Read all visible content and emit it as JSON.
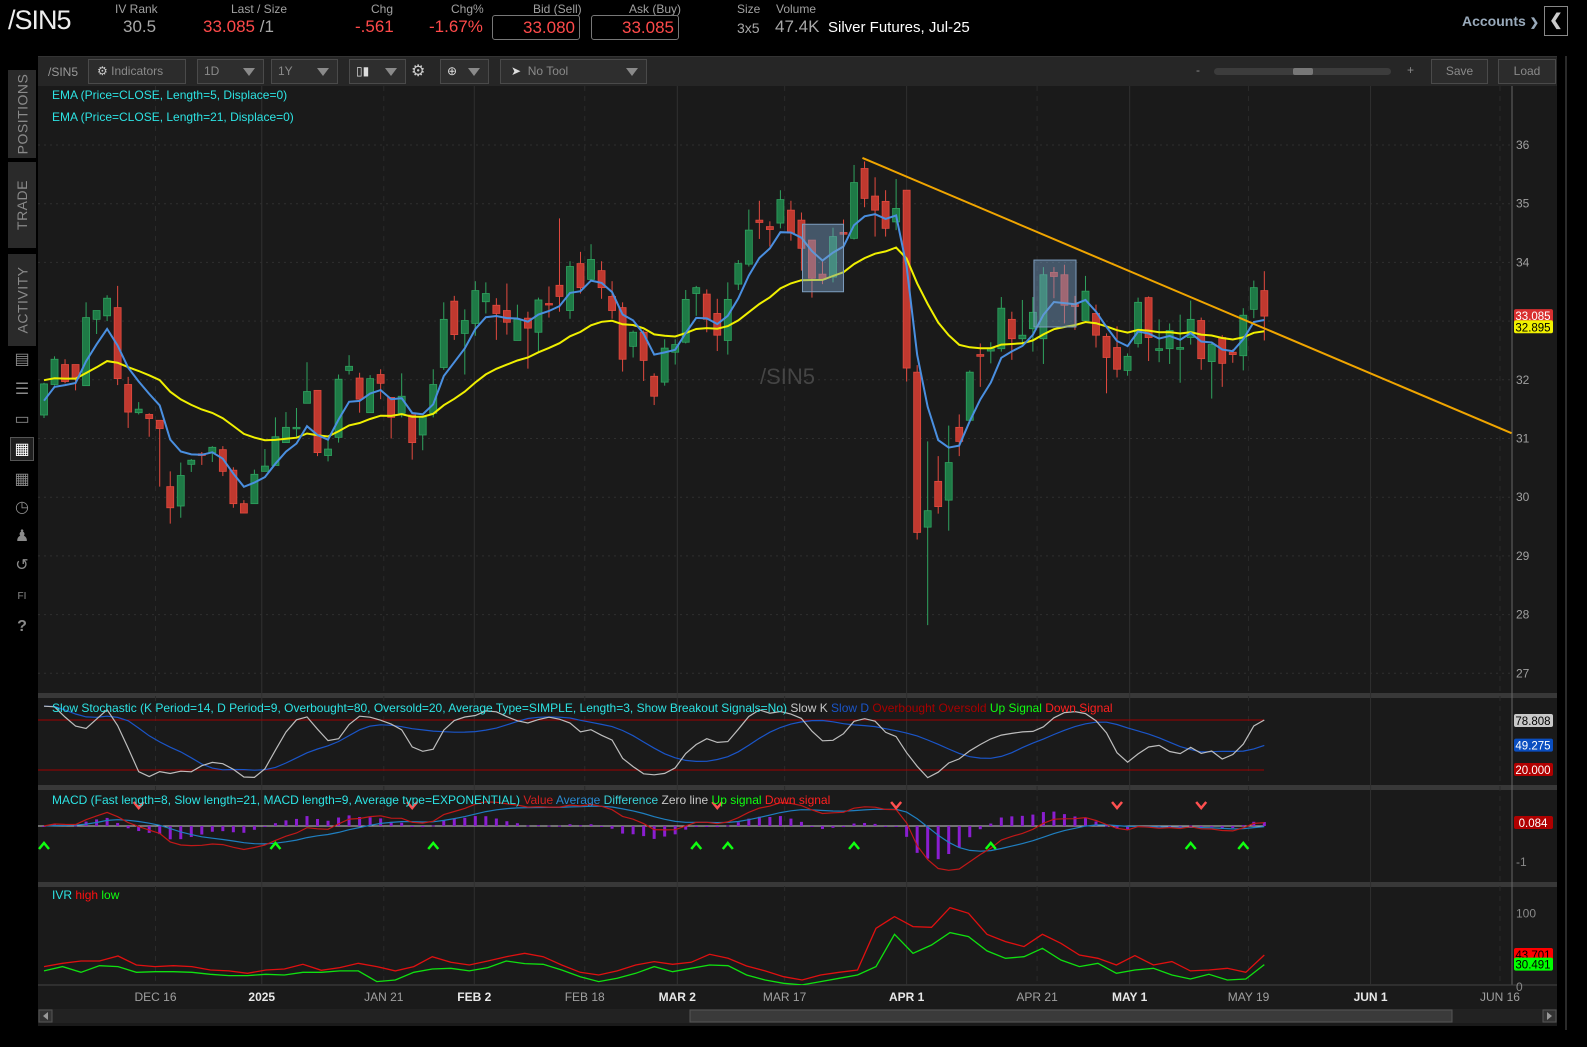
{
  "header": {
    "symbol": "/SIN5",
    "iv_rank_label": "IV Rank",
    "iv_rank": "30.5",
    "last_size_label": "Last / Size",
    "last": "33.085",
    "size_suffix": "/1",
    "chg_label": "Chg",
    "chg": "-.561",
    "chg_pct_label": "Chg%",
    "chg_pct": "-1.67%",
    "bid_label": "Bid (Sell)",
    "bid": "33.080",
    "ask_label": "Ask (Buy)",
    "ask": "33.085",
    "size_label": "Size",
    "size": "3x5",
    "volume_label": "Volume",
    "volume": "47.4K",
    "description": "Silver Futures, Jul-25",
    "accounts_label": "Accounts"
  },
  "sidebar": {
    "tabs": [
      "POSITIONS",
      "TRADE",
      "ACTIVITY"
    ],
    "icons": [
      "reports-icon",
      "list-icon",
      "tv-icon",
      "chart-grid-icon",
      "layout-icon",
      "clock-icon",
      "community-icon",
      "history-icon",
      "fi-icon",
      "help-icon"
    ]
  },
  "toolbar": {
    "symbol": "/SIN5",
    "indicators": "Indicators",
    "aggregation": "1D",
    "time_frame": "1Y",
    "tool": "No Tool",
    "zoom_minus": "-",
    "zoom_plus": "+",
    "save": "Save",
    "load": "Load",
    "zoom_level": 0.5
  },
  "studies": {
    "ema5": "EMA (Price=CLOSE, Length=5, Displace=0)",
    "ema21": "EMA (Price=CLOSE, Length=21, Displace=0)",
    "watermark": "/SIN5",
    "stoch": {
      "title": "Slow Stochastic (K Period=14, D Period=9, Overbought=80, Oversold=20, Average Type=SIMPLE, Length=3, Show Breakout Signals=No)",
      "slow_k": "Slow K",
      "slow_d": "Slow D",
      "overbought": "Overbought",
      "oversold": "Oversold",
      "up": "Up Signal",
      "down": "Down Signal"
    },
    "macd": {
      "title": "MACD (Fast length=8, Slow length=21, MACD length=9, Average type=EXPONENTIAL)",
      "value": "Value",
      "average": "Average",
      "difference": "Difference",
      "zero": "Zero line",
      "up": "Up signal",
      "down": "Down signal"
    },
    "ivr": {
      "title": "IVR",
      "high": "high",
      "low": "low"
    }
  },
  "colors": {
    "up_candle": "#1e7a46",
    "up_border": "#2fa35f",
    "down_candle": "#c0392f",
    "down_border": "#e24a3f",
    "ema5": "#4a8fe0",
    "ema21": "#f0f000",
    "trendline": "#f0a500"
  },
  "chart_data": {
    "type": "candlestick",
    "title": "/SIN5",
    "ylim": [
      26.6,
      36.7
    ],
    "price_ticks": [
      27,
      28,
      29,
      30,
      31,
      32,
      33,
      34,
      35,
      36
    ],
    "x_labels": [
      {
        "text": "DEC 16",
        "index": 10.6,
        "major": false
      },
      {
        "text": "2025",
        "index": 20.7,
        "major": true
      },
      {
        "text": "JAN 21",
        "index": 32.3,
        "major": false
      },
      {
        "text": "FEB 2",
        "index": 40.9,
        "major": true
      },
      {
        "text": "FEB 18",
        "index": 51.4,
        "major": false
      },
      {
        "text": "MAR 2",
        "index": 60.2,
        "major": true
      },
      {
        "text": "MAR 17",
        "index": 70.4,
        "major": false
      },
      {
        "text": "APR 1",
        "index": 82.0,
        "major": true
      },
      {
        "text": "APR 21",
        "index": 94.4,
        "major": false
      },
      {
        "text": "MAY 1",
        "index": 103.2,
        "major": true
      },
      {
        "text": "MAY 19",
        "index": 114.5,
        "major": false
      },
      {
        "text": "JUN 1",
        "index": 126.1,
        "major": true
      },
      {
        "text": "JUN 16",
        "index": 138.4,
        "major": false
      }
    ],
    "ohlc": [
      [
        31.4,
        31.95,
        31.35,
        31.93
      ],
      [
        31.92,
        32.4,
        31.9,
        32.35
      ],
      [
        32.26,
        32.35,
        31.94,
        31.97
      ],
      [
        32.26,
        32.26,
        31.82,
        32.02
      ],
      [
        31.9,
        33.32,
        31.9,
        33.06
      ],
      [
        33.03,
        33.18,
        32.78,
        33.18
      ],
      [
        33.09,
        33.44,
        33.0,
        33.39
      ],
      [
        33.23,
        33.6,
        31.91,
        32.02
      ],
      [
        31.92,
        32.05,
        31.18,
        31.45
      ],
      [
        31.44,
        31.62,
        31.41,
        31.5
      ],
      [
        31.41,
        31.43,
        31.03,
        31.34
      ],
      [
        31.31,
        31.31,
        30.18,
        31.17
      ],
      [
        30.18,
        30.44,
        29.55,
        29.82
      ],
      [
        29.85,
        30.59,
        29.65,
        30.37
      ],
      [
        30.56,
        30.65,
        30.43,
        30.63
      ],
      [
        30.74,
        30.77,
        30.55,
        30.71
      ],
      [
        30.76,
        30.87,
        30.6,
        30.85
      ],
      [
        30.81,
        30.87,
        30.36,
        30.44
      ],
      [
        30.46,
        30.51,
        29.82,
        29.89
      ],
      [
        29.89,
        29.95,
        29.73,
        29.73
      ],
      [
        29.89,
        30.47,
        29.89,
        30.39
      ],
      [
        30.44,
        30.82,
        30.44,
        30.53
      ],
      [
        30.54,
        31.36,
        30.54,
        31.03
      ],
      [
        30.93,
        31.45,
        30.93,
        31.19
      ],
      [
        31.17,
        31.52,
        31.03,
        31.19
      ],
      [
        31.6,
        32.3,
        31.6,
        31.8
      ],
      [
        31.82,
        31.82,
        30.7,
        30.76
      ],
      [
        30.71,
        30.97,
        30.61,
        30.82
      ],
      [
        31.02,
        32.09,
        30.93,
        32.01
      ],
      [
        32.16,
        32.42,
        32.09,
        32.23
      ],
      [
        32.03,
        32.12,
        31.44,
        31.67
      ],
      [
        31.44,
        32.08,
        31.44,
        32.02
      ],
      [
        32.09,
        32.18,
        31.67,
        31.94
      ],
      [
        31.7,
        31.7,
        31.0,
        31.36
      ],
      [
        31.43,
        32.11,
        31.36,
        31.72
      ],
      [
        31.4,
        31.4,
        30.64,
        30.93
      ],
      [
        31.06,
        31.37,
        30.8,
        31.37
      ],
      [
        31.43,
        32.18,
        31.36,
        31.92
      ],
      [
        32.21,
        33.32,
        32.17,
        33.03
      ],
      [
        33.34,
        33.43,
        32.68,
        32.77
      ],
      [
        32.79,
        33.2,
        32.09,
        33.01
      ],
      [
        32.96,
        33.68,
        32.75,
        33.52
      ],
      [
        33.33,
        33.66,
        33.13,
        33.47
      ],
      [
        33.27,
        33.39,
        32.68,
        33.13
      ],
      [
        33.18,
        33.64,
        32.77,
        32.98
      ],
      [
        32.67,
        33.28,
        32.67,
        33.03
      ],
      [
        33.05,
        33.16,
        32.19,
        32.88
      ],
      [
        32.81,
        33.4,
        32.48,
        33.36
      ],
      [
        33.3,
        33.59,
        33.06,
        33.29
      ],
      [
        33.61,
        34.75,
        33.16,
        33.42
      ],
      [
        33.18,
        34.02,
        33.04,
        33.93
      ],
      [
        33.98,
        34.18,
        33.47,
        33.57
      ],
      [
        33.71,
        34.31,
        33.67,
        34.05
      ],
      [
        33.86,
        34.02,
        33.38,
        33.57
      ],
      [
        33.42,
        33.68,
        33.04,
        33.18
      ],
      [
        33.23,
        33.32,
        32.14,
        32.35
      ],
      [
        32.57,
        32.84,
        32.38,
        32.81
      ],
      [
        32.81,
        32.84,
        31.98,
        32.33
      ],
      [
        32.06,
        32.11,
        31.57,
        31.72
      ],
      [
        31.96,
        32.69,
        31.9,
        32.54
      ],
      [
        32.47,
        32.69,
        32.26,
        32.6
      ],
      [
        32.64,
        33.53,
        32.62,
        33.37
      ],
      [
        33.47,
        33.6,
        33.09,
        33.57
      ],
      [
        33.46,
        33.54,
        32.81,
        33.03
      ],
      [
        33.13,
        33.38,
        32.49,
        32.76
      ],
      [
        32.67,
        33.66,
        32.43,
        33.37
      ],
      [
        33.63,
        34.04,
        33.53,
        33.98
      ],
      [
        33.97,
        34.9,
        33.93,
        34.55
      ],
      [
        34.72,
        35.05,
        34.4,
        34.68
      ],
      [
        34.61,
        34.7,
        34.27,
        34.56
      ],
      [
        34.67,
        35.23,
        34.58,
        35.07
      ],
      [
        34.89,
        35.05,
        34.37,
        34.5
      ],
      [
        34.72,
        34.85,
        33.86,
        34.24
      ],
      [
        34.38,
        34.38,
        33.4,
        33.73
      ],
      [
        33.8,
        34.02,
        33.63,
        33.71
      ],
      [
        33.75,
        34.59,
        33.66,
        34.44
      ],
      [
        34.51,
        34.73,
        34.24,
        34.48
      ],
      [
        34.41,
        35.66,
        34.39,
        35.36
      ],
      [
        35.6,
        35.72,
        34.94,
        35.09
      ],
      [
        35.13,
        35.45,
        34.44,
        34.89
      ],
      [
        35.04,
        35.23,
        34.44,
        34.58
      ],
      [
        34.69,
        35.42,
        34.55,
        34.92
      ],
      [
        35.23,
        35.23,
        31.97,
        32.2
      ],
      [
        32.13,
        32.25,
        29.28,
        29.4
      ],
      [
        29.49,
        30.95,
        27.82,
        29.77
      ],
      [
        30.27,
        30.7,
        29.72,
        29.84
      ],
      [
        29.95,
        31.22,
        29.43,
        30.59
      ],
      [
        31.19,
        31.41,
        30.7,
        30.95
      ],
      [
        31.31,
        32.16,
        31.3,
        32.13
      ],
      [
        32.43,
        32.62,
        31.88,
        32.4
      ],
      [
        32.49,
        32.64,
        32.28,
        32.53
      ],
      [
        32.53,
        33.41,
        32.48,
        33.22
      ],
      [
        33.03,
        33.16,
        32.34,
        32.7
      ],
      [
        32.7,
        33.36,
        32.62,
        32.76
      ],
      [
        32.87,
        33.41,
        32.48,
        33.15
      ],
      [
        32.7,
        33.92,
        32.27,
        33.79
      ],
      [
        33.83,
        33.92,
        33.39,
        33.76
      ],
      [
        33.79,
        33.96,
        32.96,
        33.27
      ],
      [
        33.28,
        33.43,
        32.85,
        33.25
      ],
      [
        33.01,
        33.77,
        33.01,
        33.51
      ],
      [
        33.13,
        33.28,
        32.55,
        32.76
      ],
      [
        32.74,
        32.79,
        31.77,
        32.38
      ],
      [
        32.55,
        32.91,
        32.04,
        32.18
      ],
      [
        32.16,
        32.45,
        32.07,
        32.4
      ],
      [
        32.62,
        33.4,
        32.55,
        33.32
      ],
      [
        33.4,
        33.42,
        32.32,
        32.72
      ],
      [
        32.5,
        33.03,
        32.3,
        32.53
      ],
      [
        32.53,
        32.96,
        32.27,
        32.84
      ],
      [
        32.52,
        33.11,
        31.95,
        32.55
      ],
      [
        32.72,
        33.35,
        32.6,
        33.03
      ],
      [
        33.01,
        33.06,
        32.17,
        32.36
      ],
      [
        32.31,
        32.62,
        31.68,
        32.6
      ],
      [
        32.72,
        32.76,
        31.88,
        32.28
      ],
      [
        32.47,
        32.52,
        32.29,
        32.43
      ],
      [
        32.41,
        33.22,
        32.16,
        33.1
      ],
      [
        33.2,
        33.69,
        33.05,
        33.57
      ],
      [
        33.52,
        33.85,
        32.67,
        33.085
      ]
    ],
    "ema5_seed": 31.5,
    "ema21_seed": 32.0,
    "trendline": {
      "start": [
        77.8,
        35.78
      ],
      "end": [
        139.5,
        31.09
      ]
    },
    "boxes": [
      {
        "from": [
          72.1,
          34.65
        ],
        "to": [
          76.0,
          33.5
        ]
      },
      {
        "from": [
          94.1,
          34.04
        ],
        "to": [
          98.1,
          32.9
        ]
      }
    ],
    "price_badges": [
      {
        "text": "33.085",
        "value": 33.085,
        "bg": "#d83030",
        "fg": "#ffffff"
      },
      {
        "text": "32.895",
        "value": 32.895,
        "bg": "#f0f000",
        "fg": "#000000"
      }
    ],
    "stoch": {
      "overbought": 80,
      "oversold": 20,
      "badges": [
        {
          "text": "78.808",
          "value": 78.808,
          "bg": "#c8c8c8",
          "fg": "#000000"
        },
        {
          "text": "49.275",
          "value": 49.275,
          "bg": "#0a4ec0",
          "fg": "#ffffff"
        },
        {
          "text": "20.000",
          "value": 20,
          "bg": "#b00000",
          "fg": "#ffffff"
        }
      ]
    },
    "macd": {
      "ticks": [
        {
          "text": "-1",
          "value": -1
        }
      ],
      "up_signals": [
        0,
        22,
        37,
        62,
        65,
        77,
        90,
        109,
        114
      ],
      "down_signals": [
        9,
        35,
        64,
        81,
        102,
        110
      ],
      "badges": [
        {
          "text": "0.084",
          "value": 0.084,
          "bg": "#b00000",
          "fg": "#ffffff"
        }
      ]
    },
    "ivr": {
      "ticks": [
        {
          "text": "100",
          "value": 100
        },
        {
          "text": "0",
          "value": 0
        }
      ],
      "high": [
        27.8,
        32.3,
        35.5,
        35.5,
        42.3,
        30.0,
        27.8,
        29.1,
        27.8,
        23.2,
        21.9,
        18.7,
        23.2,
        24.6,
        31.0,
        22.8,
        26.4,
        32.3,
        27.8,
        21.9,
        27.8,
        41.4,
        33.7,
        30.0,
        35.5,
        41.4,
        46.0,
        41.4,
        30.0,
        20.0,
        16.4,
        21.9,
        30.0,
        34.6,
        31.0,
        33.7,
        44.6,
        39.1,
        28.7,
        21.9,
        14.1,
        9.6,
        16.4,
        20.0,
        23.2,
        80.1,
        96.0,
        82.4,
        81.4,
        108.3,
        100.5,
        71.9,
        61.9,
        55.1,
        71.9,
        59.6,
        43.7,
        39.1,
        30.0,
        42.8,
        30.0,
        34.6,
        21.9,
        23.2,
        25.5,
        20.0,
        43.7
      ],
      "low": [
        21.9,
        27.8,
        20.0,
        29.1,
        27.8,
        20.0,
        20.9,
        20.9,
        20.0,
        17.3,
        15.5,
        15.5,
        17.3,
        16.4,
        20.0,
        20.0,
        21.9,
        21.9,
        7.3,
        9.6,
        20.0,
        24.6,
        25.5,
        21.9,
        26.4,
        35.5,
        31.9,
        31.0,
        23.2,
        14.1,
        7.3,
        11.9,
        18.7,
        27.8,
        20.9,
        25.5,
        30.0,
        29.1,
        16.4,
        9.6,
        5.0,
        2.8,
        7.3,
        11.9,
        16.4,
        27.8,
        71.9,
        46.0,
        57.3,
        74.2,
        68.7,
        49.2,
        39.1,
        41.4,
        52.8,
        36.9,
        27.8,
        32.3,
        18.7,
        23.2,
        25.5,
        16.4,
        10.9,
        17.3,
        9.6,
        10.9,
        30.5
      ],
      "badges": [
        {
          "text": "43.701",
          "value": 43.701,
          "bg": "#ff0000",
          "fg": "#000000"
        },
        {
          "text": "30.491",
          "value": 30.491,
          "bg": "#00ff00",
          "fg": "#000000"
        }
      ]
    }
  }
}
